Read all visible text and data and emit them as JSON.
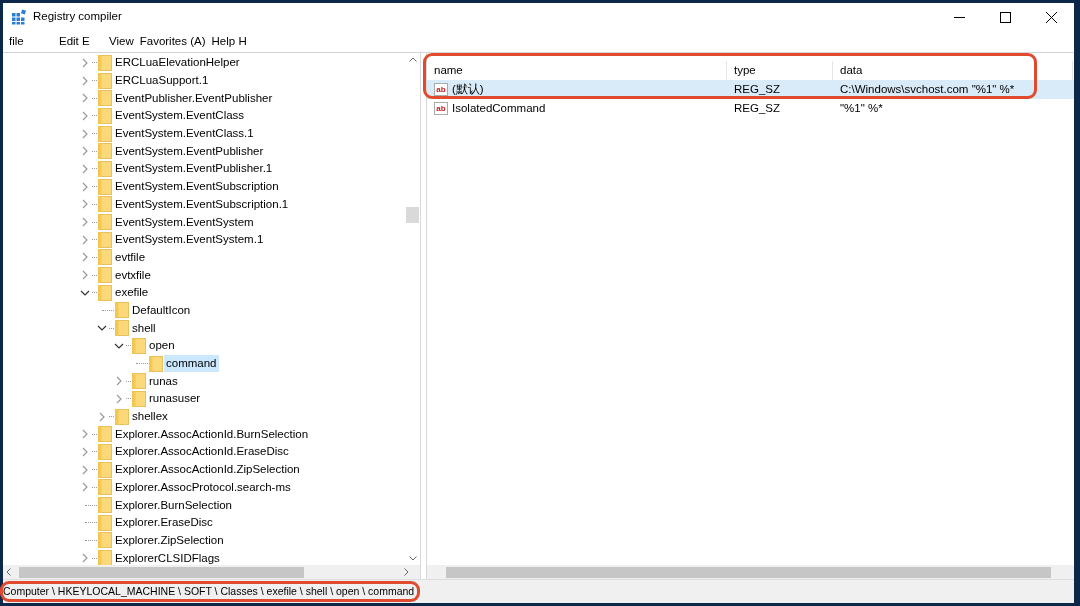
{
  "window": {
    "title": "Registry compiler"
  },
  "menu": [
    "file",
    "Edit E",
    "View",
    "Favorites (A)",
    "Help H"
  ],
  "tree": [
    {
      "label": "ERCLuaElevationHelper",
      "kind": "node",
      "expanded": false,
      "selected": false
    },
    {
      "label": "ERCLuaSupport.1",
      "kind": "node",
      "expanded": false,
      "selected": false
    },
    {
      "label": "EventPublisher.EventPublisher",
      "kind": "node",
      "expanded": false,
      "selected": false
    },
    {
      "label": "EventSystem.EventClass",
      "kind": "node",
      "expanded": false,
      "selected": false
    },
    {
      "label": "EventSystem.EventClass.1",
      "kind": "node",
      "expanded": false,
      "selected": false
    },
    {
      "label": "EventSystem.EventPublisher",
      "kind": "node",
      "expanded": false,
      "selected": false
    },
    {
      "label": "EventSystem.EventPublisher.1",
      "kind": "node",
      "expanded": false,
      "selected": false
    },
    {
      "label": "EventSystem.EventSubscription",
      "kind": "node",
      "expanded": false,
      "selected": false
    },
    {
      "label": "EventSystem.EventSubscription.1",
      "kind": "node",
      "expanded": false,
      "selected": false
    },
    {
      "label": "EventSystem.EventSystem",
      "kind": "node",
      "expanded": false,
      "selected": false
    },
    {
      "label": "EventSystem.EventSystem.1",
      "kind": "node",
      "expanded": false,
      "selected": false
    },
    {
      "label": "evtfile",
      "kind": "node",
      "expanded": false,
      "selected": false
    },
    {
      "label": "evtxfile",
      "kind": "node",
      "expanded": false,
      "selected": false
    },
    {
      "label": "exefile",
      "kind": "node",
      "expanded": true,
      "selected": false,
      "children": [
        {
          "label": "DefaultIcon",
          "kind": "leaf",
          "selected": false
        },
        {
          "label": "shell",
          "kind": "node",
          "expanded": true,
          "selected": false,
          "children": [
            {
              "label": "open",
              "kind": "node",
              "expanded": true,
              "selected": false,
              "children": [
                {
                  "label": "command",
                  "kind": "leaf",
                  "selected": true
                }
              ]
            },
            {
              "label": "runas",
              "kind": "node",
              "expanded": false,
              "selected": false
            },
            {
              "label": "runasuser",
              "kind": "node",
              "expanded": false,
              "selected": false
            }
          ]
        },
        {
          "label": "shellex",
          "kind": "node",
          "expanded": false,
          "selected": false
        }
      ]
    },
    {
      "label": "Explorer.AssocActionId.BurnSelection",
      "kind": "node",
      "expanded": false,
      "selected": false
    },
    {
      "label": "Explorer.AssocActionId.EraseDisc",
      "kind": "node",
      "expanded": false,
      "selected": false
    },
    {
      "label": "Explorer.AssocActionId.ZipSelection",
      "kind": "node",
      "expanded": false,
      "selected": false
    },
    {
      "label": "Explorer.AssocProtocol.search-ms",
      "kind": "node",
      "expanded": false,
      "selected": false
    },
    {
      "label": "Explorer.BurnSelection",
      "kind": "leaf",
      "selected": false
    },
    {
      "label": "Explorer.EraseDisc",
      "kind": "leaf",
      "selected": false
    },
    {
      "label": "Explorer.ZipSelection",
      "kind": "leaf",
      "selected": false
    },
    {
      "label": "ExplorerCLSIDFlags",
      "kind": "node",
      "expanded": false,
      "selected": false
    }
  ],
  "values": {
    "highlighted": true,
    "columns": [
      "name",
      "type",
      "data"
    ],
    "rows": [
      {
        "icon": "ab",
        "name": "(默认)",
        "type": "REG_SZ",
        "data": "C:\\Windows\\svchost.com \"%1\" %*",
        "selected": true,
        "highlighted": true
      },
      {
        "icon": "ab",
        "name": "IsolatedCommand",
        "type": "REG_SZ",
        "data": "\"%1\" %*",
        "selected": false,
        "highlighted": false
      }
    ]
  },
  "status_bar": {
    "text": "Computer \\ HKEYLOCAL_MACHINE \\ SOFT \\ Classes \\ exefile \\ shell \\ open \\ command",
    "highlighted": true
  }
}
